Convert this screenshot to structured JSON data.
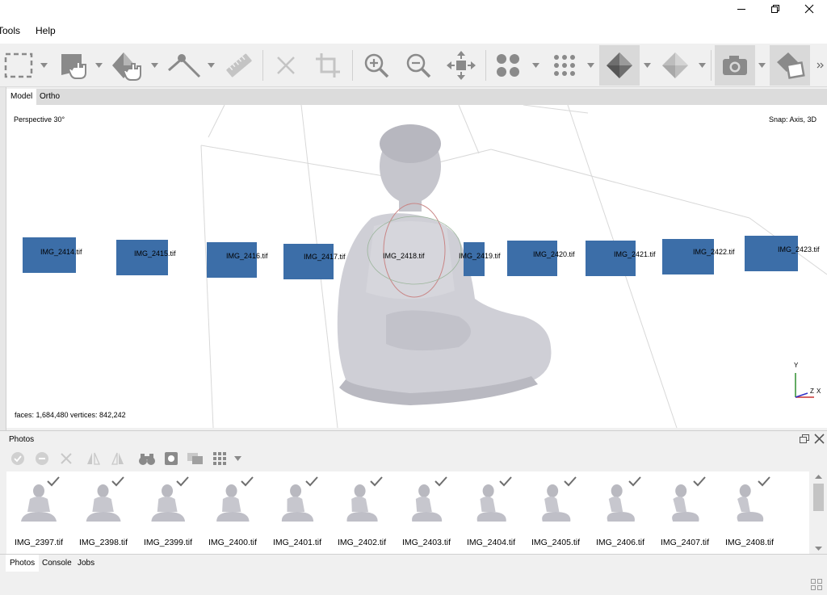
{
  "menu": {
    "tools": "Tools",
    "help": "Help"
  },
  "view_tabs": {
    "model": "Model",
    "ortho": "Ortho"
  },
  "viewport": {
    "projection": "Perspective 30°",
    "snap": "Snap: Axis, 3D",
    "stats": "faces: 1,684,480 vertices: 842,242",
    "axis_y": "Y",
    "axis_z": "Z",
    "axis_x": "X",
    "cameras": [
      "IMG_2414.tif",
      "IMG_2415.tif",
      "IMG_2416.tif",
      "IMG_2417.tif",
      "IMG_2418.tif",
      "IMG_2419.tif",
      "IMG_2420.tif",
      "IMG_2421.tif",
      "IMG_2422.tif",
      "IMG_2423.tif"
    ]
  },
  "photos": {
    "title": "Photos",
    "items": [
      "IMG_2397.tif",
      "IMG_2398.tif",
      "IMG_2399.tif",
      "IMG_2400.tif",
      "IMG_2401.tif",
      "IMG_2402.tif",
      "IMG_2403.tif",
      "IMG_2404.tif",
      "IMG_2405.tif",
      "IMG_2406.tif",
      "IMG_2407.tif",
      "IMG_2408.tif"
    ]
  },
  "bottom_tabs": {
    "photos": "Photos",
    "console": "Console",
    "jobs": "Jobs"
  },
  "colors": {
    "camera": "#3c6ea8",
    "icon": "#8a8a8a",
    "icon_disabled": "#c4c4c4"
  }
}
